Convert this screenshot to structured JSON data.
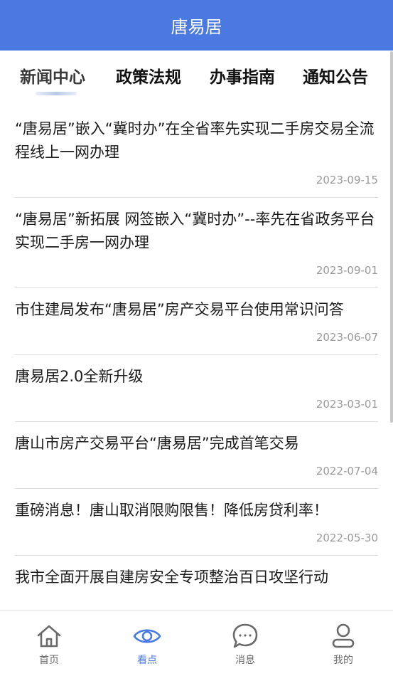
{
  "header": {
    "title": "唐易居"
  },
  "tabs": [
    {
      "label": "新闻中心"
    },
    {
      "label": "政策法规"
    },
    {
      "label": "办事指南"
    },
    {
      "label": "通知公告"
    }
  ],
  "news": [
    {
      "title": "“唐易居”嵌入“冀时办”在全省率先实现二手房交易全流程线上一网办理",
      "date": "2023-09-15"
    },
    {
      "title": "“唐易居”新拓展 网签嵌入“冀时办”--率先在省政务平台实现二手房一网办理",
      "date": "2023-09-01"
    },
    {
      "title": "市住建局发布“唐易居”房产交易平台使用常识问答",
      "date": "2023-06-07"
    },
    {
      "title": "唐易居2.0全新升级",
      "date": "2023-03-01"
    },
    {
      "title": "唐山市房产交易平台“唐易居”完成首笔交易",
      "date": "2022-07-04"
    },
    {
      "title": "重磅消息！唐山取消限购限售！降低房贷利率！",
      "date": "2022-05-30"
    },
    {
      "title": "我市全面开展自建房安全专项整治百日攻坚行动",
      "date": ""
    }
  ],
  "bottom_nav": [
    {
      "label": "首页",
      "icon": "home-icon"
    },
    {
      "label": "看点",
      "icon": "eye-icon"
    },
    {
      "label": "消息",
      "icon": "chat-icon"
    },
    {
      "label": "我的",
      "icon": "user-icon"
    }
  ],
  "colors": {
    "primary": "#4a79e2",
    "date": "#9a9a9a",
    "nav_inactive": "#6a6a6a"
  }
}
